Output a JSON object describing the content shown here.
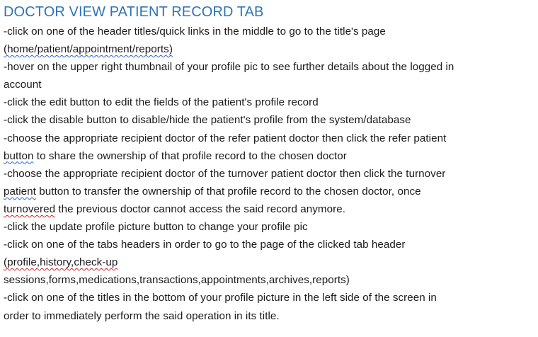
{
  "document": {
    "title": "DOCTOR VIEW PATIENT RECORD TAB",
    "lines": [
      "-click on one of the header titles/quick links in the middle to go to the title's page",
      "(home/patient/appointment/reports)",
      "-hover on the upper right thumbnail of your profile pic to see further details about the logged in",
      "account",
      "-click the edit button to edit the fields of the patient's profile record",
      "-click the disable button to disable/hide the patient's profile from the system/database",
      "-choose the appropriate recipient doctor of the refer patient doctor then click the refer patient",
      "button to share the ownership of that profile record to the chosen doctor",
      "-choose the appropriate recipient doctor of the turnover patient doctor then click the turnover",
      "patient button to transfer the ownership of that profile record to the chosen doctor, once",
      "turnovered the previous doctor cannot access the said record anymore.",
      "-click the update profile picture button to change your profile pic",
      "-click on one of the tabs headers in order to go to the page of the clicked tab header",
      "(profile,history,check-up",
      "sessions,forms,medications,transactions,appointments,archives,reports)",
      "-click on one of the titles in the bottom of your profile picture in the left side of the screen in",
      "order to immediately perform the said operation in its title."
    ]
  }
}
